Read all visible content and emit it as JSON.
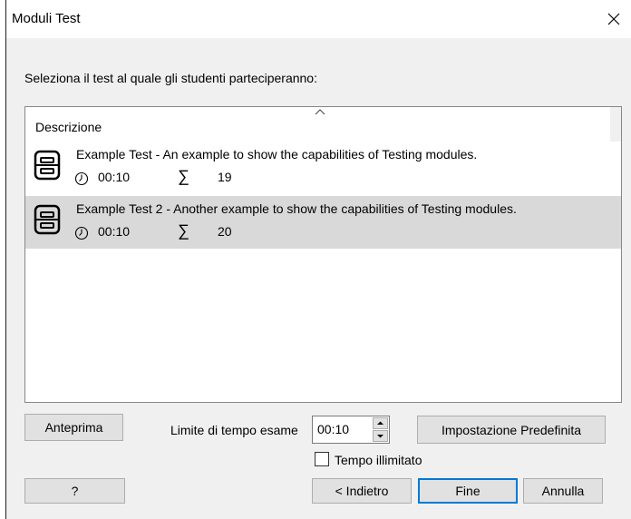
{
  "window": {
    "title": "Moduli Test"
  },
  "prompt": "Seleziona il test al quale gli studenti parteciperanno:",
  "list": {
    "column_header": "Descrizione",
    "items": [
      {
        "title": "Example Test - An example to show the capabilities of Testing modules.",
        "time": "00:10",
        "count": "19",
        "selected": false
      },
      {
        "title": "Example Test 2 - Another example to show the capabilities of Testing modules.",
        "time": "00:10",
        "count": "20",
        "selected": true
      }
    ]
  },
  "controls": {
    "preview_label": "Anteprima",
    "time_limit_label": "Limite di tempo esame",
    "time_limit_value": "00:10",
    "default_settings_label": "Impostazione Predefinita",
    "unlimited_time_label": "Tempo illimitato",
    "unlimited_time_checked": false
  },
  "footer": {
    "help_label": "?",
    "back_label": "< Indietro",
    "finish_label": "Fine",
    "cancel_label": "Annulla"
  },
  "colors": {
    "selection": "#d9d9d9",
    "default_button_border": "#0078d7",
    "button_face": "#e1e1e1"
  },
  "icons": {
    "close": "close-icon",
    "sort": "sort-up-icon",
    "test": "test-document-icon",
    "clock": "clock-icon",
    "sigma": "sigma-icon"
  }
}
